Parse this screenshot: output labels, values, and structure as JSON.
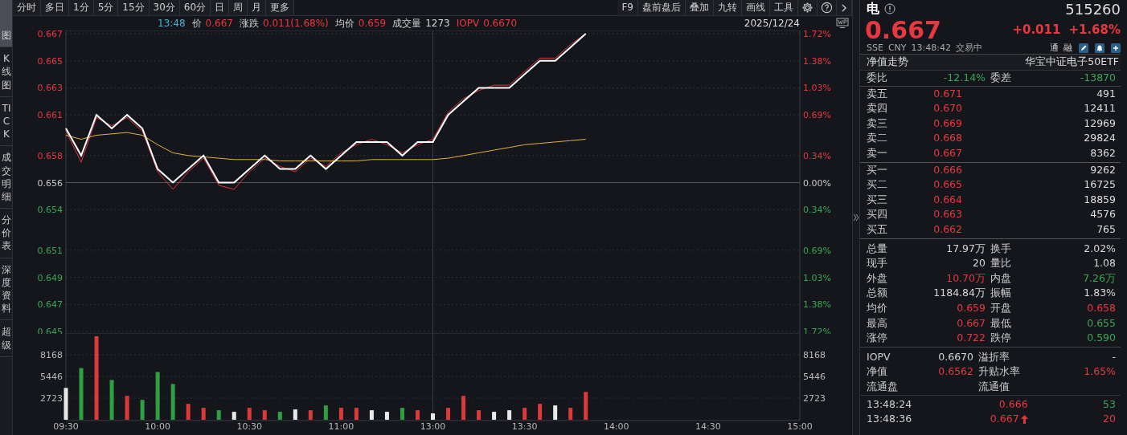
{
  "toolbar": {
    "periods": [
      {
        "label": "分时"
      },
      {
        "label": "多日"
      },
      {
        "label": "1分"
      },
      {
        "label": "5分"
      },
      {
        "label": "15分"
      },
      {
        "label": "30分"
      },
      {
        "label": "60分"
      },
      {
        "label": "日"
      },
      {
        "label": "周"
      },
      {
        "label": "月"
      },
      {
        "label": "更多"
      }
    ],
    "tools": [
      "F9",
      "盘前盘后",
      "叠加",
      "九转",
      "画线",
      "工具"
    ]
  },
  "side_tabs": [
    {
      "label": "图",
      "selected": true
    },
    {
      "label": "K线图",
      "selected": false
    },
    {
      "label": "TICK",
      "selected": false
    },
    {
      "label": "成交明细",
      "selected": false
    },
    {
      "label": "分价表",
      "selected": false
    },
    {
      "label": "深度资料",
      "selected": false
    },
    {
      "label": "超级",
      "selected": false
    }
  ],
  "info_bar": {
    "time": "13:48",
    "date": "2025/12/24",
    "items": [
      {
        "label": "价",
        "value": "0.667",
        "color": "#e8383f",
        "label_colored": false
      },
      {
        "label": "涨跌",
        "value": "0.011(1.68%)",
        "color": "#e8383f",
        "label_colored": false
      },
      {
        "label": "均价",
        "value": "0.659",
        "color": "#e8383f",
        "label_colored": false
      },
      {
        "label": "成交量",
        "value": "1273",
        "color": "#d6d6d6",
        "label_colored": false
      },
      {
        "label": "IOPV",
        "value": "0.6670",
        "color": "#e8383f",
        "label_colored": true
      }
    ]
  },
  "price_chart": {
    "chart_data": {
      "type": "line",
      "categories": [
        null,
        null,
        null,
        null,
        null,
        null,
        null,
        null,
        null,
        null,
        null,
        null,
        null,
        null,
        null,
        null,
        null,
        null,
        null,
        null,
        null,
        null,
        null,
        null,
        null,
        null,
        null,
        null,
        null,
        null,
        null,
        null,
        null,
        null,
        null,
        null,
        null,
        null,
        null,
        null,
        null,
        null,
        null,
        null,
        null,
        null,
        null,
        null,
        null
      ],
      "ylim": [
        0.645,
        0.667
      ],
      "grid": true,
      "ref_lines": [
        {
          "axis": "y",
          "value": 0.656
        }
      ],
      "yticks": [
        {
          "value": 0.645,
          "label": "0.645"
        },
        {
          "value": 0.647,
          "label": "0.647"
        },
        {
          "value": 0.649,
          "label": "0.649"
        },
        {
          "value": 0.651,
          "label": "0.651"
        },
        {
          "value": 0.654,
          "label": "0.654"
        },
        {
          "value": 0.656,
          "label": "0.656"
        },
        {
          "value": 0.658,
          "label": "0.658"
        },
        {
          "value": 0.661,
          "label": "0.661"
        },
        {
          "value": 0.663,
          "label": "0.663"
        },
        {
          "value": 0.665,
          "label": "0.665"
        },
        {
          "value": 0.667,
          "label": "0.667"
        }
      ],
      "series": [
        {
          "color": "#e0353d",
          "values": [
            0.6598,
            0.6575,
            0.6608,
            0.6602,
            0.6608,
            0.6598,
            0.6568,
            0.6555,
            0.6568,
            0.6578,
            0.6558,
            0.6555,
            0.6568,
            0.6578,
            0.6572,
            0.6568,
            0.6578,
            0.6572,
            0.6582,
            0.6588,
            0.6592,
            0.6588,
            0.6582,
            0.6588,
            0.6592,
            0.6612,
            0.6622,
            0.6628,
            0.6632,
            0.6632,
            0.6642,
            0.6652,
            0.6652,
            0.6662,
            0.667,
            null,
            null,
            null,
            null,
            null,
            null,
            null,
            null,
            null,
            null,
            null,
            null,
            null,
            null
          ]
        },
        {
          "color": "#e0b23c",
          "values": [
            0.6595,
            0.6592,
            0.6595,
            0.6596,
            0.6597,
            0.6595,
            0.6588,
            0.6582,
            0.658,
            0.6579,
            0.6578,
            0.6577,
            0.6577,
            0.6577,
            0.6576,
            0.6576,
            0.6576,
            0.6576,
            0.6576,
            0.6576,
            0.6577,
            0.6577,
            0.6577,
            0.6577,
            0.6577,
            0.6578,
            0.658,
            0.6582,
            0.6584,
            0.6586,
            0.6588,
            0.6589,
            0.659,
            0.6591,
            0.6592,
            null,
            null,
            null,
            null,
            null,
            null,
            null,
            null,
            null,
            null,
            null,
            null,
            null,
            null
          ]
        },
        {
          "color": "#ffffff",
          "values": [
            0.66,
            0.658,
            0.661,
            0.66,
            0.661,
            0.66,
            0.657,
            0.656,
            0.657,
            0.658,
            0.656,
            0.656,
            0.657,
            0.658,
            0.657,
            0.657,
            0.658,
            0.657,
            0.658,
            0.659,
            0.659,
            0.659,
            0.658,
            0.659,
            0.659,
            0.661,
            0.662,
            0.663,
            0.663,
            0.663,
            0.664,
            0.665,
            0.665,
            0.666,
            0.667,
            null,
            null,
            null,
            null,
            null,
            null,
            null,
            null,
            null,
            null,
            null,
            null,
            null,
            null
          ]
        }
      ]
    },
    "right_axis": [
      "1.72%",
      "1.38%",
      "1.03%",
      "0.69%",
      "0.34%",
      "0.00%",
      "0.34%",
      "0.69%",
      "1.03%",
      "1.38%",
      "1.72%"
    ]
  },
  "volume_chart": {
    "chart_data": {
      "type": "bar",
      "ylim": [
        0,
        10900
      ],
      "grid": true,
      "categories": [
        "09:30",
        null,
        null,
        null,
        null,
        null,
        "10:00",
        null,
        null,
        null,
        null,
        null,
        "10:30",
        null,
        null,
        null,
        null,
        null,
        "11:00",
        null,
        null,
        null,
        null,
        null,
        "13:00",
        null,
        null,
        null,
        null,
        null,
        "13:30",
        null,
        null,
        null,
        null,
        null,
        "14:00",
        null,
        null,
        null,
        null,
        null,
        "14:30",
        null,
        null,
        null,
        null,
        null,
        "15:00"
      ],
      "yticks": [
        {
          "value": 2723,
          "label": "2723"
        },
        {
          "value": 5446,
          "label": "5446"
        },
        {
          "value": 8168,
          "label": "8168"
        }
      ],
      "values": [
        4000,
        6500,
        10500,
        5000,
        3000,
        2500,
        6000,
        4500,
        2000,
        1500,
        1200,
        1000,
        1500,
        1200,
        1000,
        1300,
        1200,
        1800,
        1500,
        1500,
        1200,
        1000,
        1500,
        1200,
        800,
        1500,
        3000,
        1200,
        1000,
        1200,
        1500,
        2000,
        1800,
        1500,
        3500,
        null,
        null,
        null,
        null,
        null,
        null,
        null,
        null,
        null,
        null,
        null,
        null,
        null,
        null
      ]
    },
    "right_axis": [
      "8168",
      "5446",
      "2723"
    ]
  },
  "quote": {
    "name": "电",
    "code": "515260",
    "price": "0.667",
    "change": "+0.011",
    "change_pct": "+1.68%",
    "exchange": "SSE",
    "currency": "CNY",
    "time": "13:48:42",
    "status": "交易中",
    "badges": [
      "通",
      "融"
    ]
  },
  "nav_row": {
    "label": "净值走势",
    "fund_name": "华宝中证电子50ETF"
  },
  "order_ratio": [
    {
      "label": "委比",
      "value": "-12.14%",
      "color": "#36a852"
    },
    {
      "label": "委差",
      "value": "-13870",
      "color": "#36a852"
    }
  ],
  "asks": [
    {
      "label": "卖五",
      "price": "0.671",
      "volume": "491"
    },
    {
      "label": "卖四",
      "price": "0.670",
      "volume": "12411"
    },
    {
      "label": "卖三",
      "price": "0.669",
      "volume": "12969"
    },
    {
      "label": "卖二",
      "price": "0.668",
      "volume": "29824"
    },
    {
      "label": "卖一",
      "price": "0.667",
      "volume": "8362"
    }
  ],
  "bids": [
    {
      "label": "买一",
      "price": "0.666",
      "volume": "9262"
    },
    {
      "label": "买二",
      "price": "0.665",
      "volume": "16725"
    },
    {
      "label": "买三",
      "price": "0.664",
      "volume": "18859"
    },
    {
      "label": "买四",
      "price": "0.663",
      "volume": "4576"
    },
    {
      "label": "买五",
      "price": "0.662",
      "volume": "765"
    }
  ],
  "stats": [
    {
      "label": "总量",
      "value": "17.97万",
      "color": "#d6d6d6"
    },
    {
      "label": "换手",
      "value": "2.02%",
      "color": "#d6d6d6"
    },
    {
      "label": "现手",
      "value": "20",
      "color": "#d6d6d6"
    },
    {
      "label": "量比",
      "value": "1.08",
      "color": "#d6d6d6"
    },
    {
      "label": "外盘",
      "value": "10.70万",
      "color": "#e8383f"
    },
    {
      "label": "内盘",
      "value": "7.26万",
      "color": "#36a852"
    },
    {
      "label": "总额",
      "value": "1184.84万",
      "color": "#d6d6d6"
    },
    {
      "label": "振幅",
      "value": "1.83%",
      "color": "#d6d6d6"
    },
    {
      "label": "均价",
      "value": "0.659",
      "color": "#e8383f"
    },
    {
      "label": "开盘",
      "value": "0.658",
      "color": "#e8383f"
    },
    {
      "label": "最高",
      "value": "0.667",
      "color": "#e8383f"
    },
    {
      "label": "最低",
      "value": "0.655",
      "color": "#36a852"
    },
    {
      "label": "涨停",
      "value": "0.722",
      "color": "#e8383f"
    },
    {
      "label": "跌停",
      "value": "0.590",
      "color": "#36a852"
    }
  ],
  "fund_stats": [
    {
      "label": "IOPV",
      "value": "0.6670",
      "color": "#d6d6d6"
    },
    {
      "label": "溢折率",
      "value": "-"
    },
    {
      "label": "净值",
      "value": "0.6562",
      "color": "#e8383f"
    },
    {
      "label": "升贴水率",
      "value": "1.65%",
      "color": "#e8383f"
    },
    {
      "label": "流通盘"
    },
    {
      "label": "流通值"
    }
  ],
  "trades": [
    {
      "time": "13:48:24",
      "price": "0.666",
      "volume": "53",
      "color": "#36a852",
      "arrow": false
    },
    {
      "time": "13:48:36",
      "price": "0.667",
      "volume": "20",
      "color": "#e8383f",
      "arrow": true
    }
  ]
}
